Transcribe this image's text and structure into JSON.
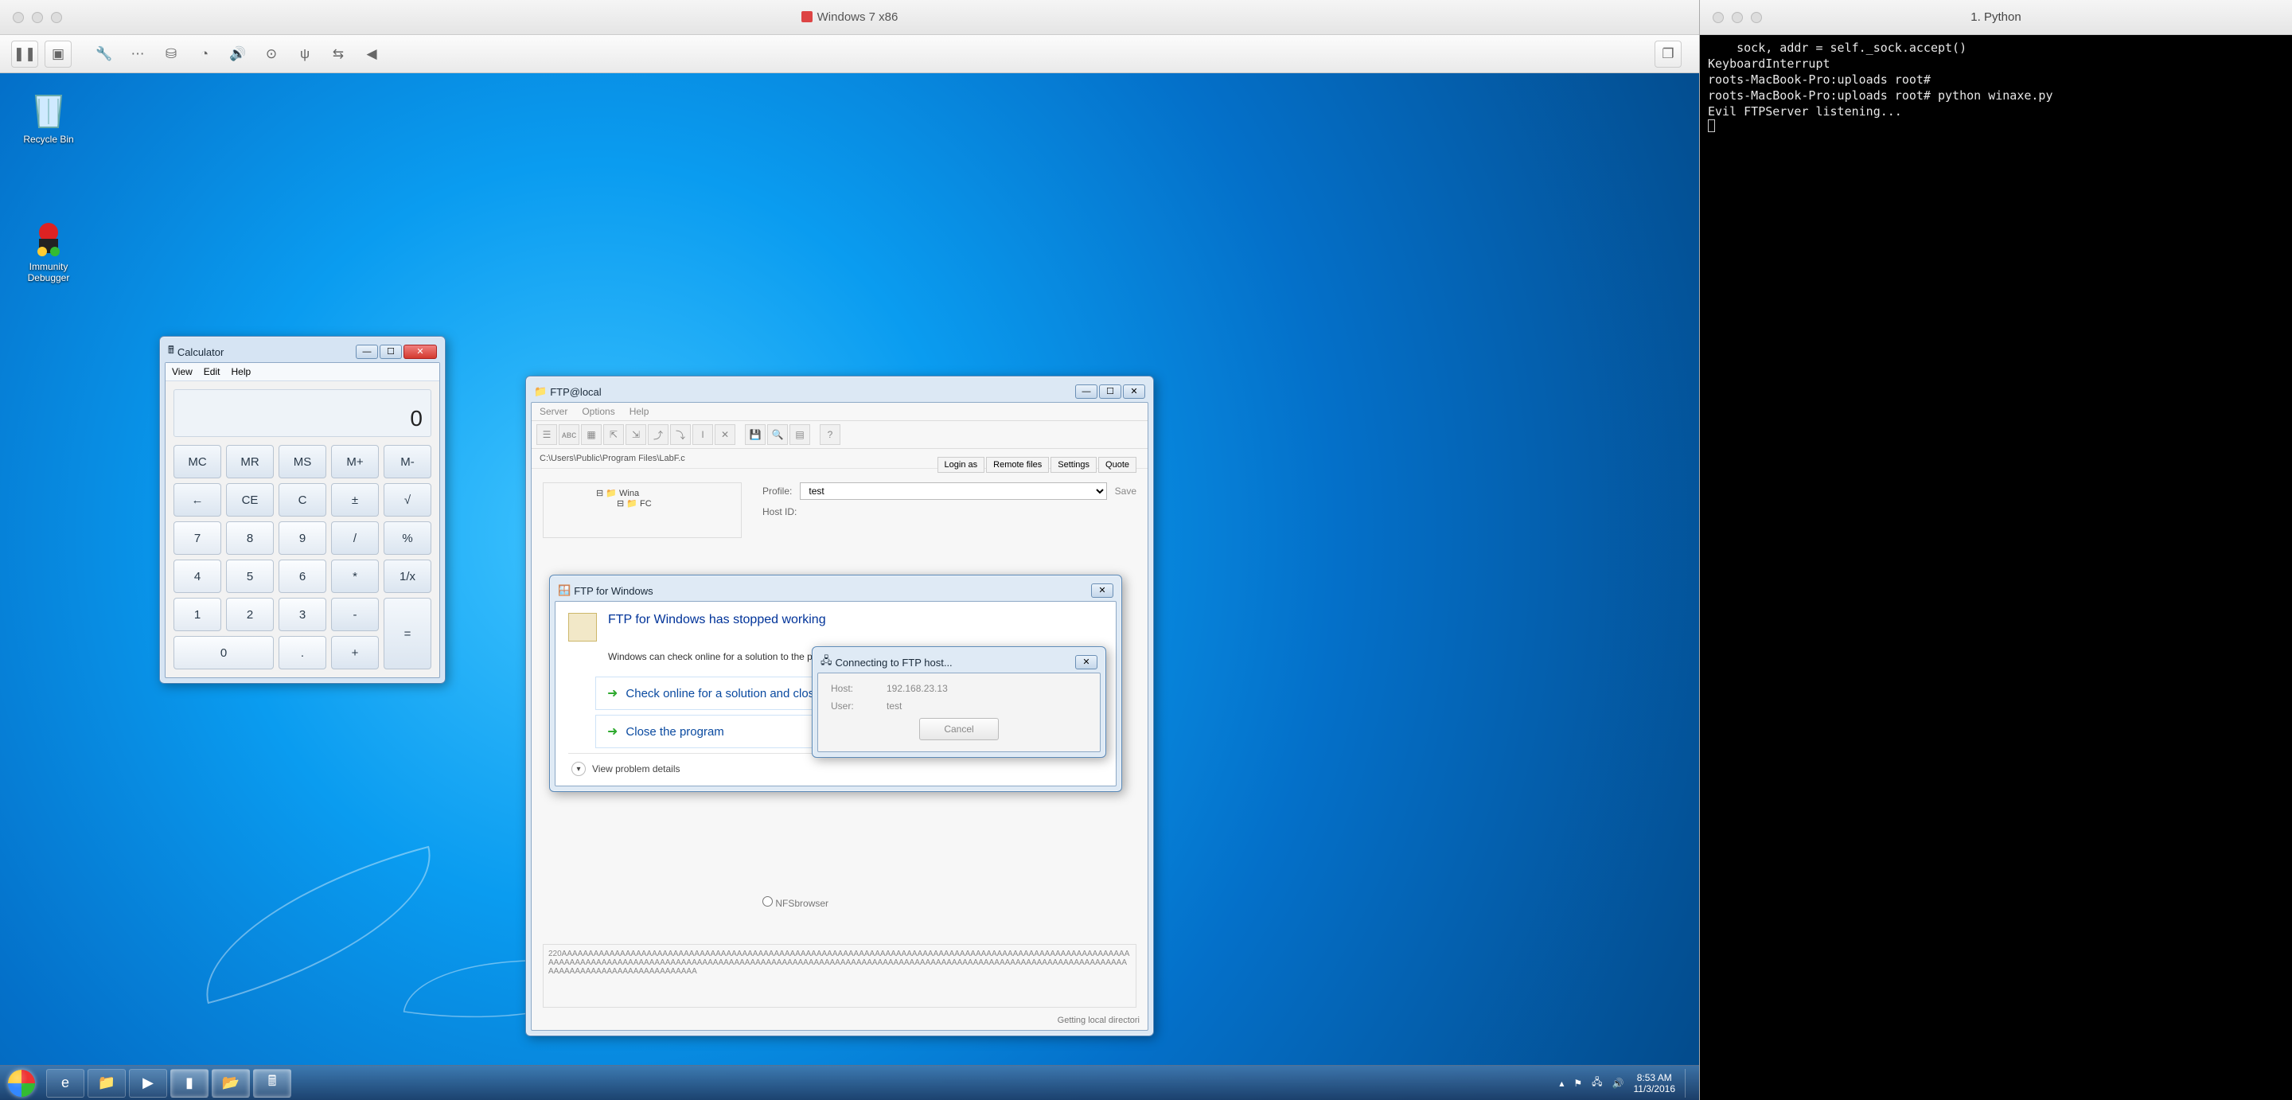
{
  "vm": {
    "title": "Windows 7 x86",
    "desktop_icons": [
      {
        "name": "Recycle Bin"
      },
      {
        "name": "Immunity Debugger"
      }
    ],
    "taskbar": {
      "clock_time": "8:53 AM",
      "clock_date": "11/3/2016"
    }
  },
  "calculator": {
    "title": "Calculator",
    "menu": [
      "View",
      "Edit",
      "Help"
    ],
    "display": "0",
    "keys": [
      "MC",
      "MR",
      "MS",
      "M+",
      "M-",
      "←",
      "CE",
      "C",
      "±",
      "√",
      "7",
      "8",
      "9",
      "/",
      "%",
      "4",
      "5",
      "6",
      "*",
      "1/x",
      "1",
      "2",
      "3",
      "-",
      "=",
      "0",
      "",
      ".",
      "+",
      ""
    ]
  },
  "ftp": {
    "title": "FTP@local",
    "menu": [
      "Server",
      "Options",
      "Help"
    ],
    "path": "C:\\Users\\Public\\Program Files\\LabF.c",
    "tabs": [
      "Login as",
      "Remote files",
      "Settings",
      "Quote"
    ],
    "tree": [
      "Wina",
      "FC"
    ],
    "profile_label": "Profile:",
    "profile_value": "test",
    "save_label": "Save",
    "hostid_label": "Host ID:",
    "nfs_label": "NFSbrowser",
    "log": "220AAAAAAAAAAAAAAAAAAAAAAAAAAAAAAAAAAAAAAAAAAAAAAAAAAAAAAAAAAAAAAAAAAAAAAAAAAAAAAAAAAAAAAAAAAAAAAAAAAAAAAAAAAAAAAAAAAAAAAAAAAAAAAAAAAAAAAAAAAAAAAAAAAAAAAAAAAAAAAAAAAAAAAAAAAAAAAAAAAAAAAAAAAAAAAAAAAAAAAAAAAAAAAAAAAAAAAAAAAAAAAAAAAAAAAAAAAAAAAAAAAAA",
    "status": "Getting local directori"
  },
  "crash": {
    "title": "FTP for Windows",
    "heading": "FTP for Windows has stopped working",
    "sub": "Windows can check online for a solution to the problem.",
    "opt1": "Check online for a solution and close the program",
    "opt2": "Close the program",
    "details": "View problem details"
  },
  "conn": {
    "title": "Connecting to FTP host...",
    "host_label": "Host:",
    "host_value": "192.168.23.13",
    "user_label": "User:",
    "user_value": "test",
    "cancel": "Cancel"
  },
  "terminal": {
    "title": "1. Python",
    "lines": [
      "    sock, addr = self._sock.accept()",
      "KeyboardInterrupt",
      "roots-MacBook-Pro:uploads root#",
      "roots-MacBook-Pro:uploads root# python winaxe.py",
      "Evil FTPServer listening..."
    ]
  }
}
